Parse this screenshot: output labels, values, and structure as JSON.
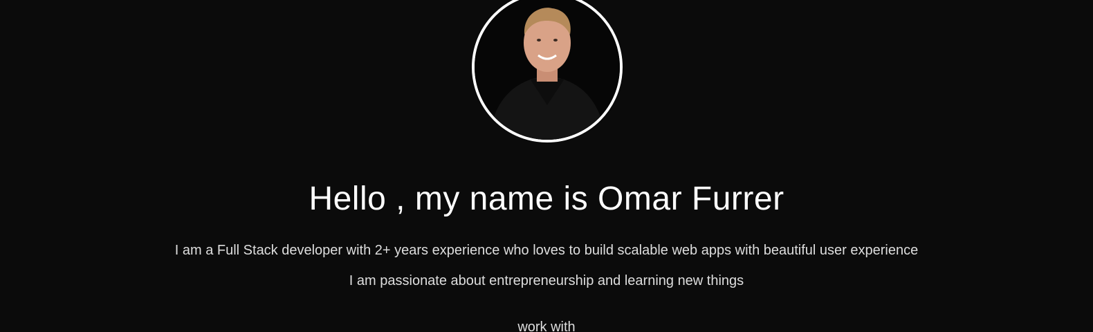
{
  "profile": {
    "avatar_alt": "Omar Furrer portrait"
  },
  "hero": {
    "title": "Hello , my name is Omar Furrer",
    "bio_line_1": "I am a Full Stack developer with 2+ years experience who loves to build scalable web apps with beautiful user experience",
    "bio_line_2": "I am passionate about entrepreneurship and learning new things",
    "work_with": "work with"
  },
  "colors": {
    "background": "#0b0b0b",
    "text": "#ffffff",
    "muted_text": "#dedede",
    "avatar_border": "#ffffff"
  }
}
